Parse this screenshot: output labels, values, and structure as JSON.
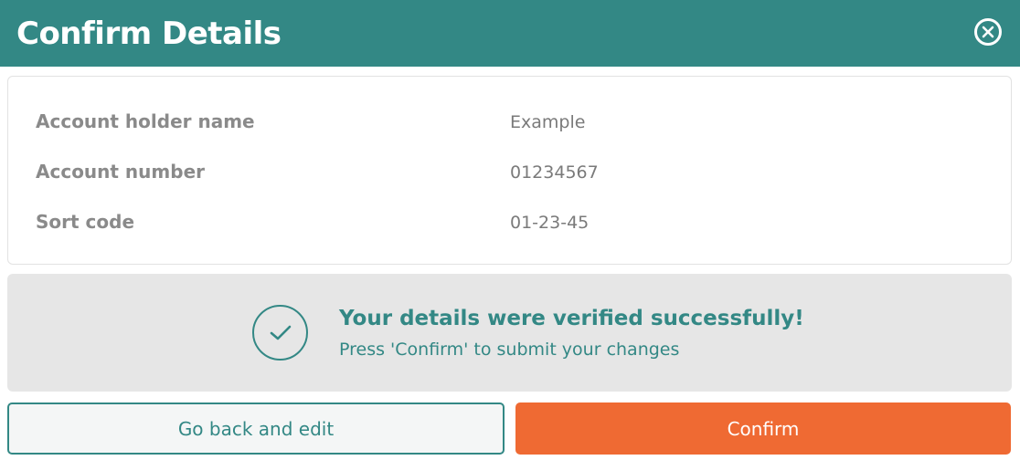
{
  "header": {
    "title": "Confirm Details",
    "close_icon": "close-circle-icon"
  },
  "details": [
    {
      "label": "Account holder name",
      "value": "Example"
    },
    {
      "label": "Account number",
      "value": "01234567"
    },
    {
      "label": "Sort code",
      "value": "01-23-45"
    }
  ],
  "verification": {
    "icon": "check-circle-icon",
    "title": "Your details were verified successfully!",
    "subtitle": "Press 'Confirm' to submit your changes"
  },
  "actions": {
    "back_label": "Go back and edit",
    "confirm_label": "Confirm"
  },
  "colors": {
    "teal": "#338885",
    "orange": "#ef6a33",
    "banner_bg": "#e6e6e6"
  }
}
